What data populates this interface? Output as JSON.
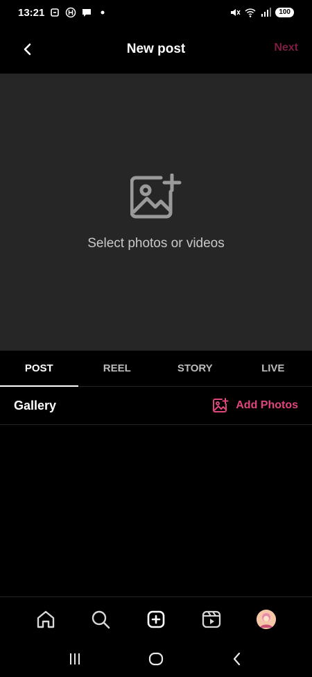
{
  "status": {
    "time": "13:21",
    "battery": "100",
    "left_icons": [
      "screen-rotate-icon",
      "h-badge-icon",
      "chat-bubble-icon",
      "dot-icon"
    ],
    "right_icons": [
      "mute-icon",
      "wifi-icon",
      "signal-icon"
    ]
  },
  "header": {
    "title": "New post",
    "next_label": "Next",
    "back_icon": "chevron-left-icon"
  },
  "preview": {
    "prompt": "Select photos or videos",
    "icon": "add-photo-icon"
  },
  "tabs": [
    {
      "label": "POST",
      "active": true
    },
    {
      "label": "REEL",
      "active": false
    },
    {
      "label": "STORY",
      "active": false
    },
    {
      "label": "LIVE",
      "active": false
    }
  ],
  "gallery": {
    "label": "Gallery",
    "add_photos_label": "Add Photos"
  },
  "bottom_nav": [
    "home-icon",
    "search-icon",
    "create-icon",
    "reels-icon",
    "profile-avatar"
  ],
  "system_nav": [
    "recent-apps-icon",
    "home-button-icon",
    "back-icon"
  ],
  "colors": {
    "accent": "#e0467e",
    "next_disabled": "#7c1d43",
    "background": "#000000",
    "preview_bg": "#262626"
  }
}
